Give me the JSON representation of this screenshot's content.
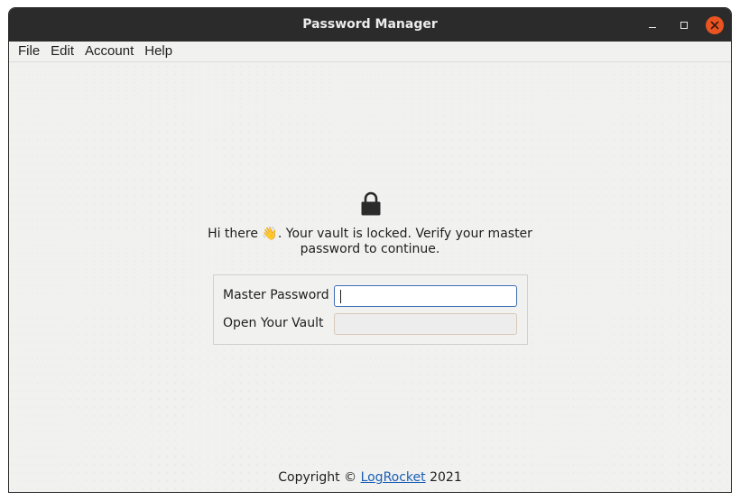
{
  "window": {
    "title": "Password Manager",
    "controls": {
      "minimize": "minimize-icon",
      "maximize": "maximize-icon",
      "close": "close-icon"
    },
    "colors": {
      "titlebar": "#2b2b2b",
      "close_button": "#e95420",
      "link": "#1a5fb4",
      "focus_border": "#3b6fb6"
    }
  },
  "menubar": {
    "items": [
      "File",
      "Edit",
      "Account",
      "Help"
    ]
  },
  "main": {
    "lock_icon": "lock-icon",
    "message_part1": "Hi there ",
    "emoji": "👋",
    "message_part2": ". Your vault is locked. Verify your master password to continue.",
    "form": {
      "master_password_label": "Master Password",
      "master_password_value": "",
      "open_vault_label": "Open Your Vault",
      "open_vault_value": ""
    }
  },
  "footer": {
    "prefix": "Copyright © ",
    "link_text": "LogRocket",
    "suffix": " 2021"
  }
}
